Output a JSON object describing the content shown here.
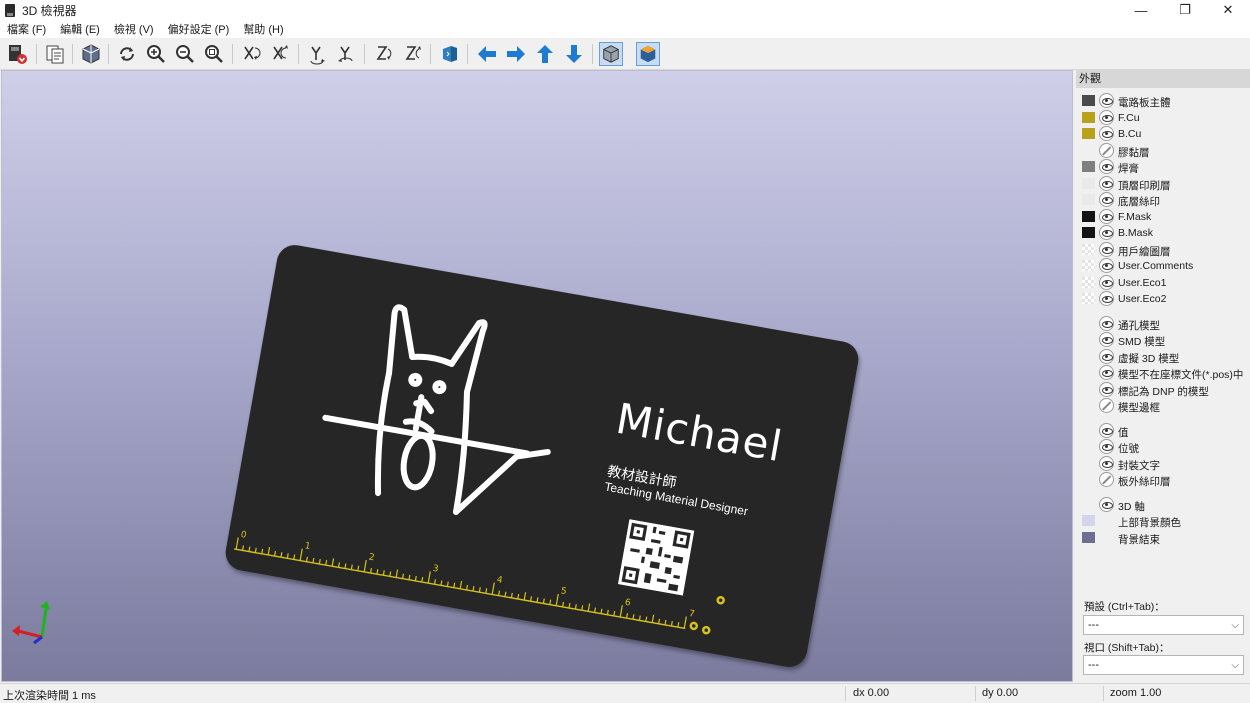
{
  "window": {
    "title": "3D 檢視器",
    "minimize": "—",
    "maximize": "❐",
    "close": "✕"
  },
  "menu": [
    "檔案 (F)",
    "編輯 (E)",
    "檢視 (V)",
    "偏好設定 (P)",
    "幫助 (H)"
  ],
  "toolbar": {
    "buttons": [
      "export-image-icon",
      "copy-to-clipboard-icon",
      "render-mode-icon",
      "reload-icon",
      "zoom-in-icon",
      "zoom-out-icon",
      "zoom-fit-icon",
      "rotate-x-cw-icon",
      "rotate-x-ccw-icon",
      "rotate-y-cw-icon",
      "rotate-y-ccw-icon",
      "rotate-z-cw-icon",
      "rotate-z-ccw-icon",
      "flip-board-icon",
      "pan-left-icon",
      "pan-right-icon",
      "pan-up-icon",
      "pan-down-icon",
      "orthographic-icon",
      "raytrace-icon"
    ],
    "active": [
      "orthographic-icon",
      "raytrace-icon"
    ]
  },
  "viewport": {
    "board_name": "Michael",
    "board_role_zh": "教材設計師",
    "board_role_en": "Teaching Material Designer",
    "ruler_labels": [
      "0",
      "1",
      "2",
      "3",
      "4",
      "5",
      "6",
      "7"
    ]
  },
  "appearance_panel": {
    "header": "外觀",
    "layers": [
      {
        "label": "電路板主體",
        "color": "#4a4a4a",
        "eye": "on"
      },
      {
        "label": "F.Cu",
        "color": "#b8a21a",
        "eye": "on"
      },
      {
        "label": "B.Cu",
        "color": "#b8a21a",
        "eye": "on"
      },
      {
        "label": "膠黏層",
        "color": "",
        "eye": "off"
      },
      {
        "label": "焊膏",
        "color": "#7f7f7f",
        "eye": "on"
      },
      {
        "label": "頂層印刷層",
        "color": "#e9e9e9",
        "eye": "on"
      },
      {
        "label": "底層絲印",
        "color": "#e9e9e9",
        "eye": "on"
      },
      {
        "label": "F.Mask",
        "color": "#141414",
        "eye": "on"
      },
      {
        "label": "B.Mask",
        "color": "#141414",
        "eye": "on"
      },
      {
        "label": "用戶繪圖層",
        "color": "checker",
        "eye": "on"
      },
      {
        "label": "User.Comments",
        "color": "checker",
        "eye": "on"
      },
      {
        "label": "User.Eco1",
        "color": "checker",
        "eye": "on"
      },
      {
        "label": "User.Eco2",
        "color": "checker",
        "eye": "on"
      }
    ],
    "models": [
      {
        "label": "通孔模型",
        "eye": "on"
      },
      {
        "label": "SMD 模型",
        "eye": "on"
      },
      {
        "label": "虛擬 3D 模型",
        "eye": "on"
      },
      {
        "label": "模型不在座標文件(*.pos)中",
        "eye": "on"
      },
      {
        "label": "標記為 DNP 的模型",
        "eye": "on"
      },
      {
        "label": "模型邊框",
        "eye": "off"
      }
    ],
    "texts": [
      {
        "label": "值",
        "eye": "on"
      },
      {
        "label": "位號",
        "eye": "on"
      },
      {
        "label": "封裝文字",
        "eye": "on"
      },
      {
        "label": "板外絲印層",
        "eye": "off"
      }
    ],
    "misc": [
      {
        "label": "3D 軸",
        "color": "",
        "eye": "on"
      },
      {
        "label": "上部背景顏色",
        "color": "#d4d4ec",
        "eye": ""
      },
      {
        "label": "背景結束",
        "color": "#6e6e92",
        "eye": ""
      }
    ],
    "preset_label": "預設 (Ctrl+Tab)：",
    "preset_value": "---",
    "viewport_label": "視口 (Shift+Tab)：",
    "viewport_value": "---"
  },
  "status": {
    "render_time": "上次渲染時間 1 ms",
    "dx": "dx 0.00",
    "dy": "dy 0.00",
    "zoom": "zoom 1.00"
  }
}
